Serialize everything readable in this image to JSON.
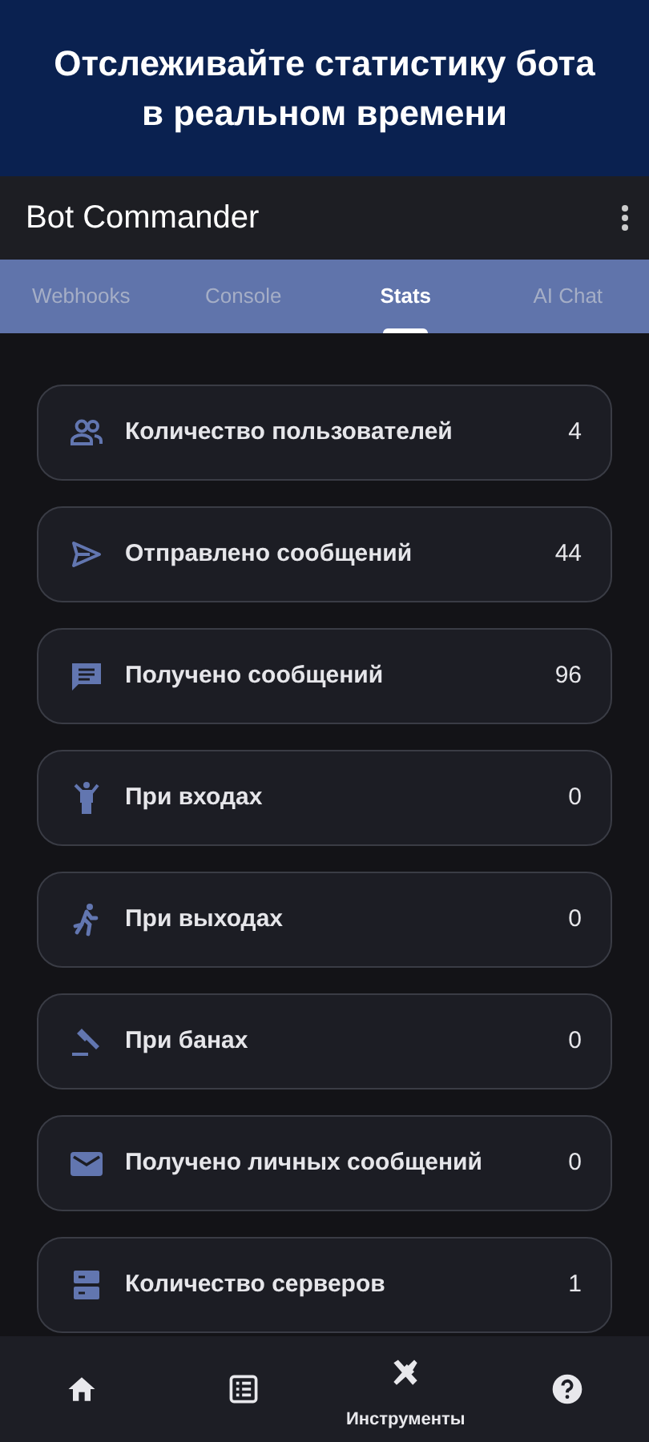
{
  "banner": {
    "text": "Отслеживайте статистику бота в реальном времени"
  },
  "app_bar": {
    "title": "Bot Commander"
  },
  "tabs": [
    {
      "label": "Webhooks",
      "selected": false
    },
    {
      "label": "Console",
      "selected": false
    },
    {
      "label": "Stats",
      "selected": true
    },
    {
      "label": "AI Chat",
      "selected": false
    }
  ],
  "stats": [
    {
      "kind": "users",
      "label": "Количество пользователей",
      "value": "4"
    },
    {
      "kind": "send",
      "label": "Отправлено сообщений",
      "value": "44"
    },
    {
      "kind": "chat",
      "label": "Получено сообщений",
      "value": "96"
    },
    {
      "kind": "join",
      "label": "При входах",
      "value": "0"
    },
    {
      "kind": "leave",
      "label": "При выходах",
      "value": "0"
    },
    {
      "kind": "ban",
      "label": "При банах",
      "value": "0"
    },
    {
      "kind": "mail",
      "label": "Получено личных сообщений",
      "value": "0"
    },
    {
      "kind": "servers",
      "label": "Количество серверов",
      "value": "1"
    }
  ],
  "bottom_nav": [
    {
      "kind": "home",
      "selected": false
    },
    {
      "kind": "list",
      "selected": false
    },
    {
      "kind": "tools",
      "selected": true,
      "label": "Инструменты"
    },
    {
      "kind": "help",
      "selected": false
    }
  ]
}
